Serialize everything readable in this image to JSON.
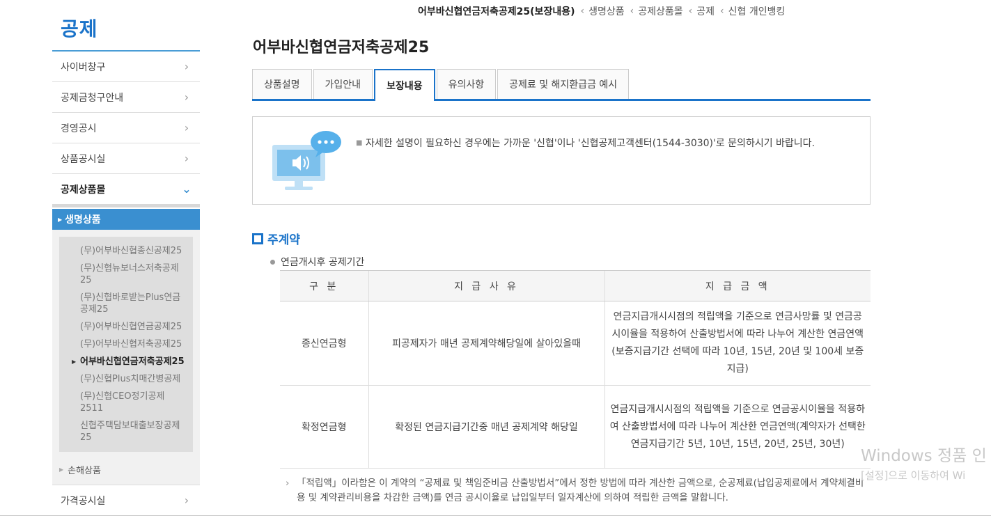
{
  "sidebar": {
    "title": "공제",
    "items": [
      {
        "label": "사이버창구"
      },
      {
        "label": "공제금청구안내"
      },
      {
        "label": "경영공시"
      },
      {
        "label": "상품공시실"
      },
      {
        "label": "공제상품몰"
      }
    ],
    "sub_head": "생명상품",
    "subitems": [
      {
        "label": "(무)어부바신협종신공제25"
      },
      {
        "label": "(무)신협뉴보너스저축공제25"
      },
      {
        "label": "(무)신협바로받는Plus연금공제25"
      },
      {
        "label": "(무)어부바신협연금공제25"
      },
      {
        "label": "(무)어부바신협저축공제25"
      },
      {
        "label": "어부바신협연금저축공제25"
      },
      {
        "label": "(무)신협Plus치매간병공제"
      },
      {
        "label": "(무)신협CEO정기공제2511"
      },
      {
        "label": "신협주택담보대출보장공제25"
      }
    ],
    "other": "손해상품",
    "last_item": "가격공시실"
  },
  "breadcrumb": {
    "current": "어부바신협연금저축공제25(보장내용)",
    "items": [
      "생명상품",
      "공제상품몰",
      "공제",
      "신협 개인뱅킹"
    ]
  },
  "page_title": "어부바신협연금저축공제25",
  "tabs": [
    "상품설명",
    "가입안내",
    "보장내용",
    "유의사항",
    "공제료 및 해지환급금 예시"
  ],
  "notice": {
    "text": "자세한 설명이 필요하신 경우에는 가까운 '신협'이나 '신협공제고객센터(1544-3030)'로 문의하시기 바랍니다."
  },
  "section": {
    "title": "주계약",
    "subtitle": "연금개시후 공제기간"
  },
  "table": {
    "headers": [
      "구 분",
      "지 급 사 유",
      "지 급 금 액"
    ],
    "rows": [
      {
        "type": "종신연금형",
        "reason": "피공제자가 매년 공제계약해당일에 살아있을때",
        "amount": "연금지급개시시점의 적립액을 기준으로 연금사망률 및 연금공시이율을 적용하여 산출방법서에 따라 나누어 계산한 연금연액(보증지급기간 선택에 따라 10년, 15년, 20년 및 100세 보증 지급)"
      },
      {
        "type": "확정연금형",
        "reason": "확정된 연금지급기간중 매년 공제계약 해당일",
        "amount": "연금지급개시시점의 적립액을 기준으로 연금공시이율을 적용하여 산출방법서에 따라 나누어 계산한 연금연액(계약자가 선택한 연금지급기간 5년, 10년, 15년, 20년, 25년, 30년)"
      }
    ]
  },
  "footnote": "「적립액」이라함은 이 계약의 “공제료 및 책임준비금 산출방법서”에서 정한 방법에 따라 계산한 금액으로, 순공제료(납입공제료에서 계약체결비용 및 계약관리비용을 차감한 금액)를 연금 공시이율로 납입일부터 일자계산에 의하여 적립한 금액을 말합니다.",
  "watermark": {
    "line1": "Windows 정품 인",
    "line2": "[설정]으로 이동하여 Wi"
  },
  "colors": {
    "accent": "#1a73c9",
    "sub_head_bg": "#3a8fd0"
  }
}
